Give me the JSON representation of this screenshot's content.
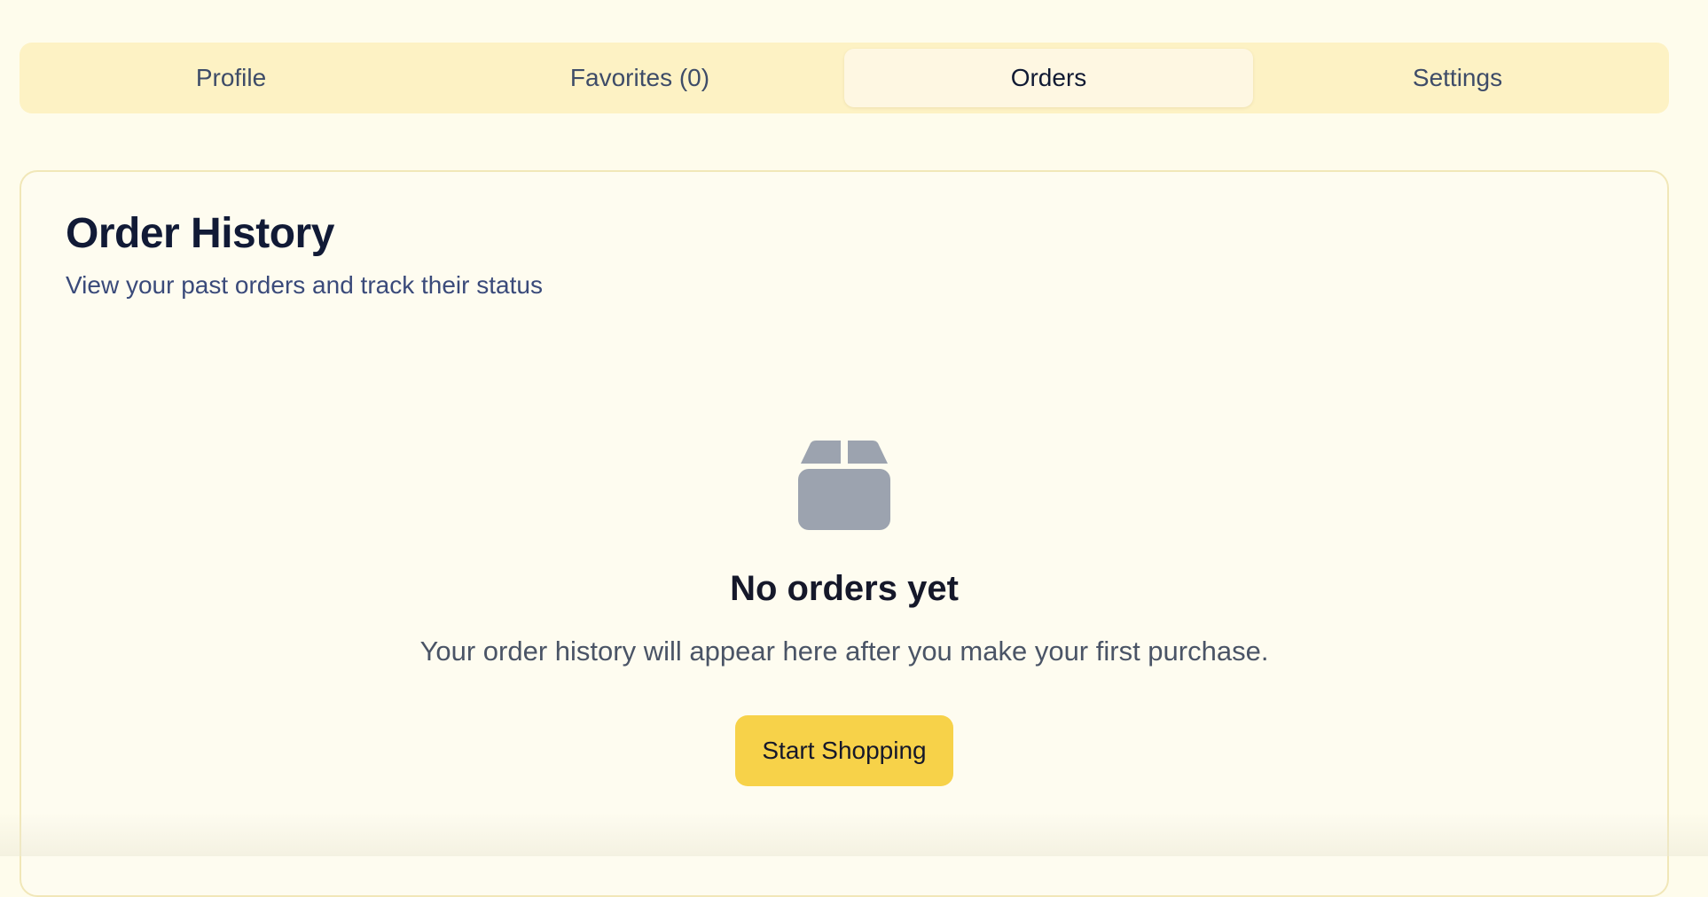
{
  "tabs": [
    {
      "label": "Profile",
      "active": false
    },
    {
      "label": "Favorites (0)",
      "active": false
    },
    {
      "label": "Orders",
      "active": true
    },
    {
      "label": "Settings",
      "active": false
    }
  ],
  "order_history": {
    "title": "Order History",
    "subtitle": "View your past orders and track their status",
    "empty_state": {
      "icon": "package-icon",
      "title": "No orders yet",
      "message": "Your order history will appear here after you make your first purchase.",
      "button_label": "Start Shopping"
    }
  },
  "colors": {
    "page_background": "#fefcec",
    "tab_bar_background": "#fdf2c4",
    "active_tab_background": "#fef7e2",
    "card_border": "#f1e7b8",
    "icon_gray": "#9ca3af",
    "primary_button": "#f7d249"
  }
}
